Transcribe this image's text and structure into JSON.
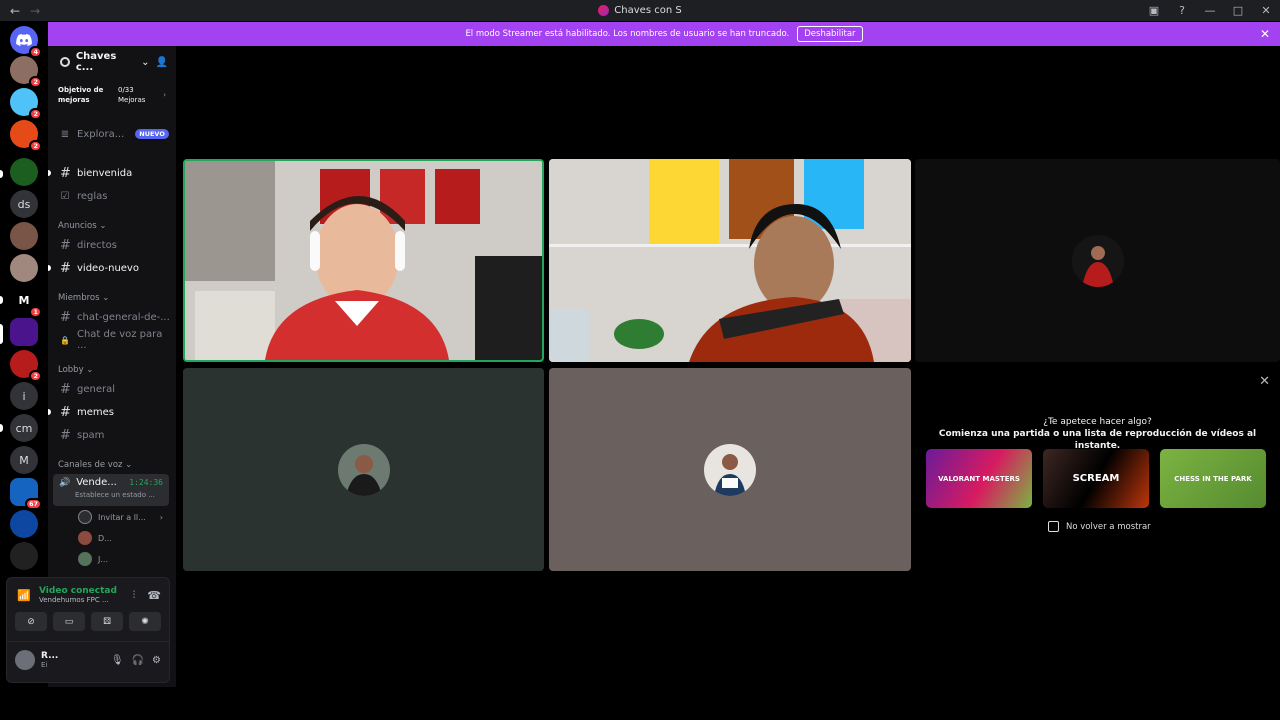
{
  "titlebar": {
    "title": "Chaves con S"
  },
  "banner": {
    "text": "El modo Streamer está habilitado. Los nombres de usuario se han truncado.",
    "button": "Deshabilitar"
  },
  "servers": [
    {
      "label": "",
      "badge": "4"
    },
    {
      "label": "",
      "badge": "2"
    },
    {
      "label": "",
      "badge": "2"
    },
    {
      "label": "",
      "badge": "2"
    },
    {
      "label": "",
      "badge": ""
    },
    {
      "label": "ds",
      "badge": ""
    },
    {
      "label": "",
      "badge": ""
    },
    {
      "label": "",
      "badge": ""
    },
    {
      "label": "",
      "badge": "1"
    },
    {
      "label": "",
      "badge": ""
    },
    {
      "label": "",
      "badge": "2"
    },
    {
      "label": "i",
      "badge": ""
    },
    {
      "label": "cm",
      "badge": ""
    },
    {
      "label": "M",
      "badge": ""
    },
    {
      "label": "",
      "badge": "67"
    },
    {
      "label": "",
      "badge": ""
    },
    {
      "label": "",
      "badge": ""
    }
  ],
  "guild": {
    "name": "Chaves c...",
    "boost_label": "Objetivo de mejoras",
    "boost_count": "0/33",
    "boost_unit": "Mejoras",
    "explore": "Explora...",
    "explore_tag": "NUEVO"
  },
  "channels": [
    {
      "name": "bienvenida",
      "icon": "#"
    },
    {
      "name": "reglas",
      "icon": "☑"
    },
    {
      "name": "directos",
      "icon": "#"
    },
    {
      "name": "video-nuevo",
      "icon": "#"
    },
    {
      "name": "chat-general-de-...",
      "icon": "#"
    },
    {
      "name": "Chat de voz para ...",
      "icon": "🔒"
    },
    {
      "name": "general",
      "icon": "#"
    },
    {
      "name": "memes",
      "icon": "#"
    },
    {
      "name": "spam",
      "icon": "#"
    }
  ],
  "categories": {
    "anuncios": "Anuncios",
    "miembros": "Miembros",
    "lobby": "Lobby",
    "voz": "Canales de voz"
  },
  "voice_channel": {
    "name": "Vende...",
    "time": "1:24:36",
    "status": "Establece un estado ..."
  },
  "voice_users": [
    {
      "name": "Invitar a ll..."
    },
    {
      "name": "D..."
    },
    {
      "name": "J..."
    }
  ],
  "panel": {
    "title": "Video conectad",
    "subtitle": "Vendehumos FPC ...",
    "user": "R...",
    "user_status": "Ei"
  },
  "activity": {
    "title": "¿Te apetece hacer algo?",
    "subtitle": "Comienza una partida o una lista de reproducción de vídeos al instante.",
    "cards": [
      "VALORANT MASTERS",
      "SCREAM",
      "CHESS IN THE PARK"
    ],
    "checkbox": "No volver a mostrar"
  }
}
